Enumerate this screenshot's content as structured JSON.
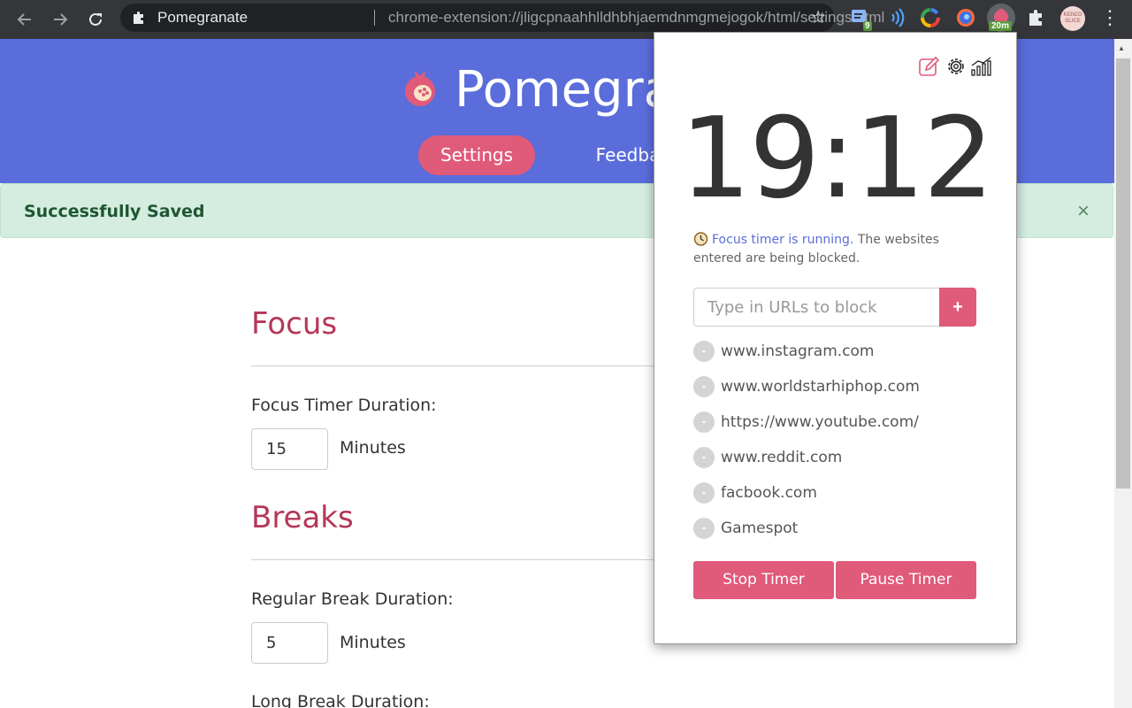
{
  "browser": {
    "tab_title": "Pomegranate",
    "url": "chrome-extension://jligcpnaahhlldhbhjaemdnmgmejogok/html/settings.html",
    "extensions": {
      "tab_manager_badge": "9",
      "pomegranate_badge": "20m"
    },
    "avatar_text": "KENZO SLICE"
  },
  "header": {
    "brand": "Pomegranate",
    "tabs": [
      {
        "label": "Settings",
        "active": true
      },
      {
        "label": "Feedba"
      }
    ]
  },
  "alert": {
    "message": "Successfully Saved",
    "close": "×"
  },
  "settings": {
    "focus": {
      "title": "Focus",
      "duration_label": "Focus Timer Duration:",
      "duration_value": "15",
      "unit": "Minutes"
    },
    "breaks": {
      "title": "Breaks",
      "regular_label": "Regular Break Duration:",
      "regular_value": "5",
      "unit": "Minutes",
      "long_label": "Long Break Duration:"
    }
  },
  "popup": {
    "timer": "19:12",
    "status_highlight": "Focus timer is running.",
    "status_rest": " The websites entered are being blocked.",
    "url_placeholder": "Type in URLs to block",
    "add_label": "+",
    "remove_label": "-",
    "blocked_sites": [
      "www.instagram.com",
      "www.worldstarhiphop.com",
      "https://www.youtube.com/",
      "www.reddit.com",
      "facbook.com",
      "Gamespot"
    ],
    "stop_label": "Stop Timer",
    "pause_label": "Pause Timer"
  },
  "colors": {
    "header_bg": "#5a6ddb",
    "accent": "#e05a7a",
    "section_title": "#b53758",
    "alert_bg": "#d4ede0"
  }
}
